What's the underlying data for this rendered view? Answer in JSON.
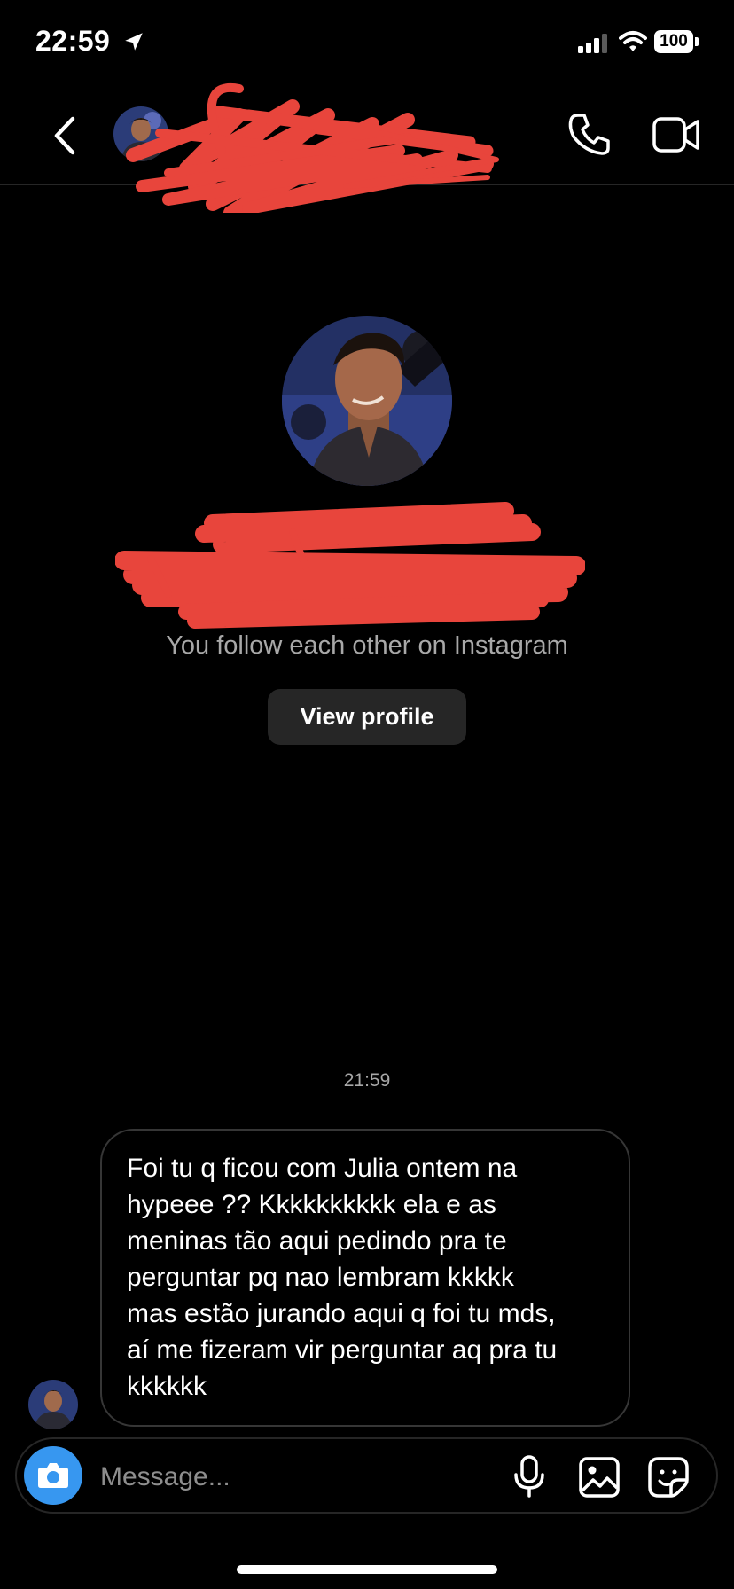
{
  "status_bar": {
    "time": "22:59",
    "battery": "100",
    "icons": [
      "location-arrow-icon",
      "signal-icon",
      "wifi-icon",
      "battery-icon"
    ]
  },
  "header": {
    "icons": [
      "back-chevron-icon",
      "phone-icon",
      "video-camera-icon"
    ]
  },
  "profile": {
    "follow_text": "You follow each other on Instagram",
    "view_profile_label": "View profile"
  },
  "conversation": {
    "timestamp": "21:59",
    "message_lines": [
      "Foi tu q ficou com Julia ontem na",
      "hypeee ?? Kkkkkkkkkk ela e as",
      "meninas tão aqui pedindo pra te",
      "perguntar pq nao lembram kkkkk",
      "mas estão jurando aqui q foi tu mds,",
      "aí me fizeram vir perguntar aq pra tu",
      "kkkkkk"
    ]
  },
  "composer": {
    "placeholder": "Message...",
    "icons": [
      "camera-icon",
      "microphone-icon",
      "gallery-icon",
      "sticker-icon"
    ]
  },
  "colors": {
    "background": "#000000",
    "accent": "#3797f0",
    "redaction": "#e8453c",
    "secondary_text": "#a8a8a8",
    "button_bg": "#262626"
  }
}
